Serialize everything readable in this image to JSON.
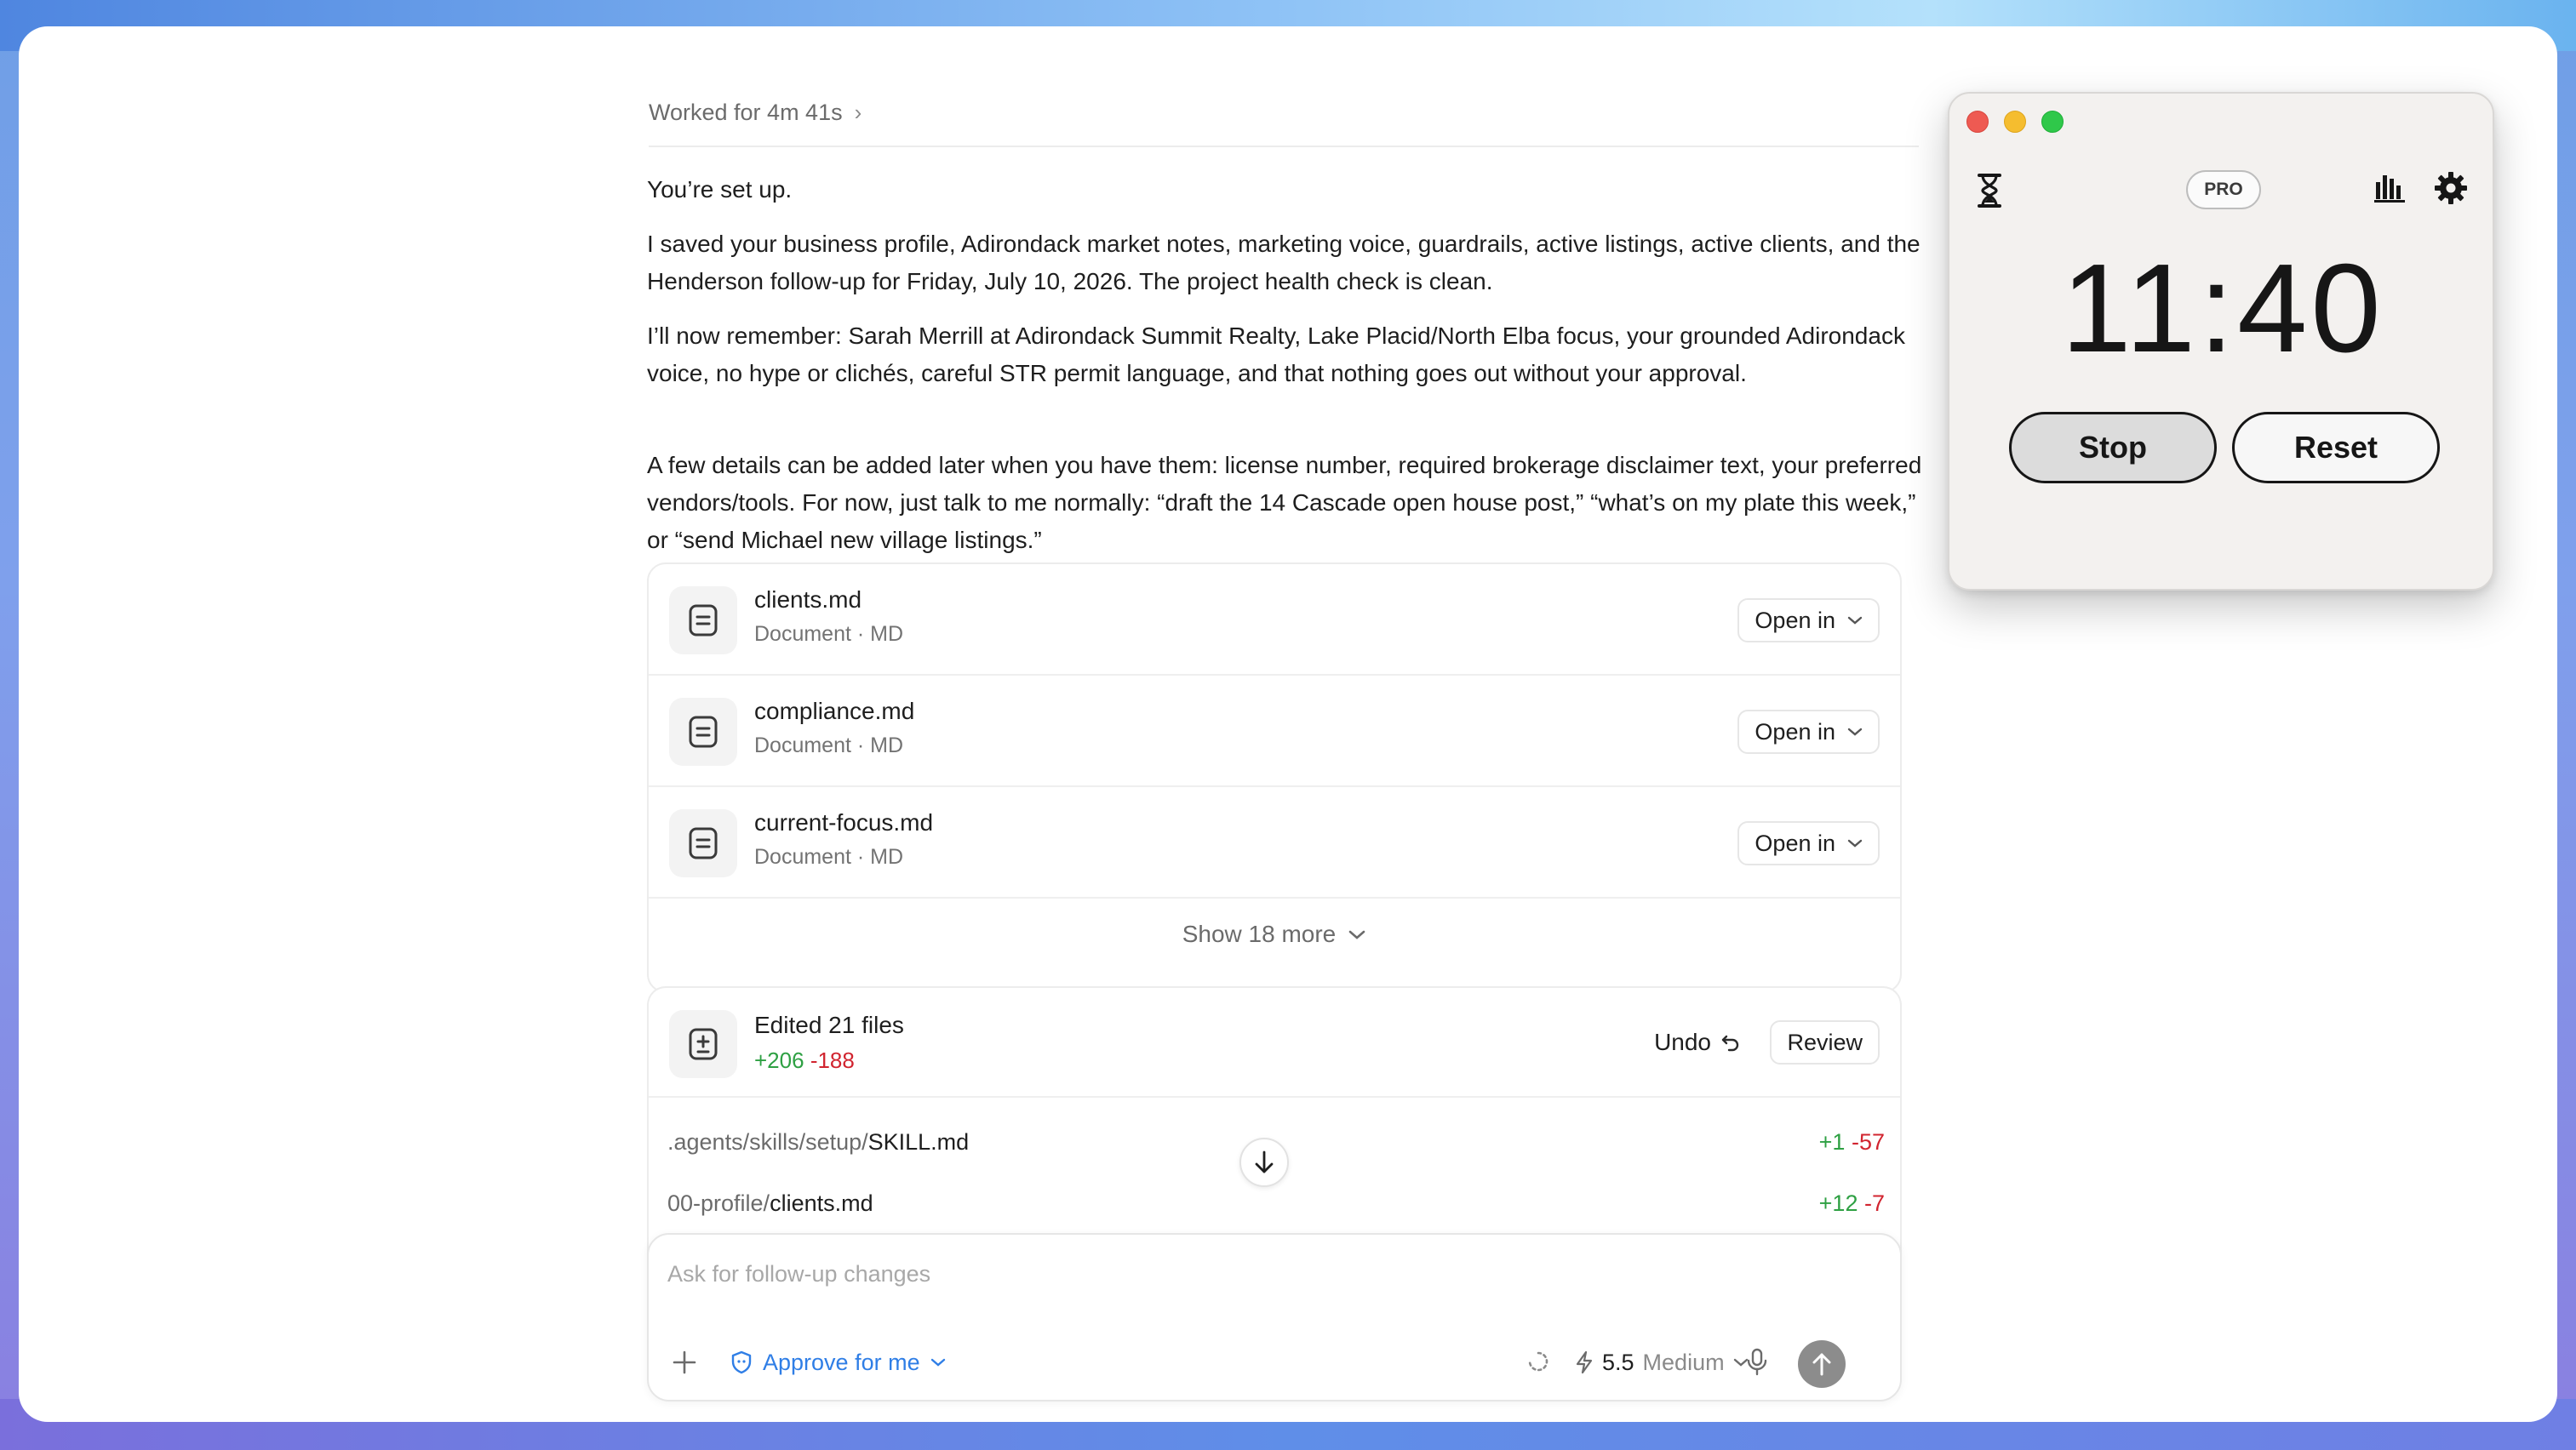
{
  "worked": {
    "label": "Worked for 4m 41s",
    "chevron": "›"
  },
  "messages": [
    "You’re set up.",
    "I saved your business profile, Adirondack market notes, marketing voice, guardrails, active listings, active clients, and the Henderson follow-up for Friday, July 10, 2026. The project health check is clean.",
    "I’ll now remember: Sarah Merrill at Adirondack Summit Realty, Lake Placid/North Elba focus, your grounded Adirondack voice, no hype or clichés, careful STR permit language, and that nothing goes out without your approval.",
    "A few details can be added later when you have them: license number, required brokerage disclaimer text, your preferred vendors/tools. For now, just talk to me normally: “draft the 14 Cascade open house post,” “what’s on my plate this week,” or “send Michael new village listings.”"
  ],
  "files": [
    {
      "name": "clients.md",
      "meta": "Document · MD",
      "action": "Open in",
      "icon": "document-icon"
    },
    {
      "name": "compliance.md",
      "meta": "Document · MD",
      "action": "Open in",
      "icon": "document-icon"
    },
    {
      "name": "current-focus.md",
      "meta": "Document · MD",
      "action": "Open in",
      "icon": "document-icon"
    }
  ],
  "show_more": "Show 18 more",
  "edited": {
    "title": "Edited 21 files",
    "additions": "+206",
    "deletions": "-188",
    "undo": "Undo",
    "review": "Review",
    "rows": [
      {
        "dir": ".agents/skills/setup/",
        "file": "SKILL.md",
        "additions": "+1",
        "deletions": "-57"
      },
      {
        "dir": "00-profile/",
        "file": "clients.md",
        "additions": "+12",
        "deletions": "-7"
      }
    ]
  },
  "composer": {
    "placeholder": "Ask for follow-up changes",
    "approve": "Approve for me",
    "model_version": "5.5",
    "model_level": "Medium"
  },
  "timer": {
    "badge": "PRO",
    "time": "11:40",
    "stop": "Stop",
    "reset": "Reset"
  },
  "colors": {
    "addition": "#2ea043",
    "deletion": "#d1242f",
    "accent": "#2f7ee6",
    "close": "#ee5a52",
    "minimize": "#f5bd2f",
    "zoom": "#2fc84a"
  }
}
